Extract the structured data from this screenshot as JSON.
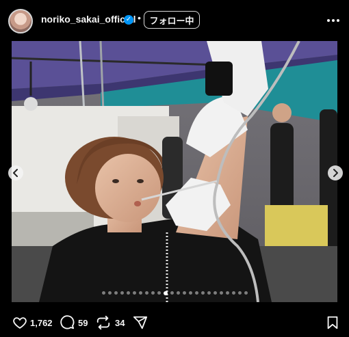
{
  "header": {
    "username": "noriko_sakai_official",
    "verified_icon": "verified-badge-icon",
    "separator": "•",
    "follow_label": "フォロー中",
    "more_icon": "more-options-icon"
  },
  "media": {
    "carousel_total": 24,
    "carousel_active_index": 10,
    "prev_icon": "chevron-left-icon",
    "next_icon": "chevron-right-icon"
  },
  "actions": {
    "like_count": "1,762",
    "comment_count": "59",
    "repost_count": "34",
    "like_icon": "heart-icon",
    "comment_icon": "comment-icon",
    "repost_icon": "repost-icon",
    "share_icon": "share-icon",
    "save_icon": "bookmark-icon"
  },
  "colors": {
    "background": "#000000",
    "text": "#f5f5f5",
    "verified": "#0095f6"
  }
}
